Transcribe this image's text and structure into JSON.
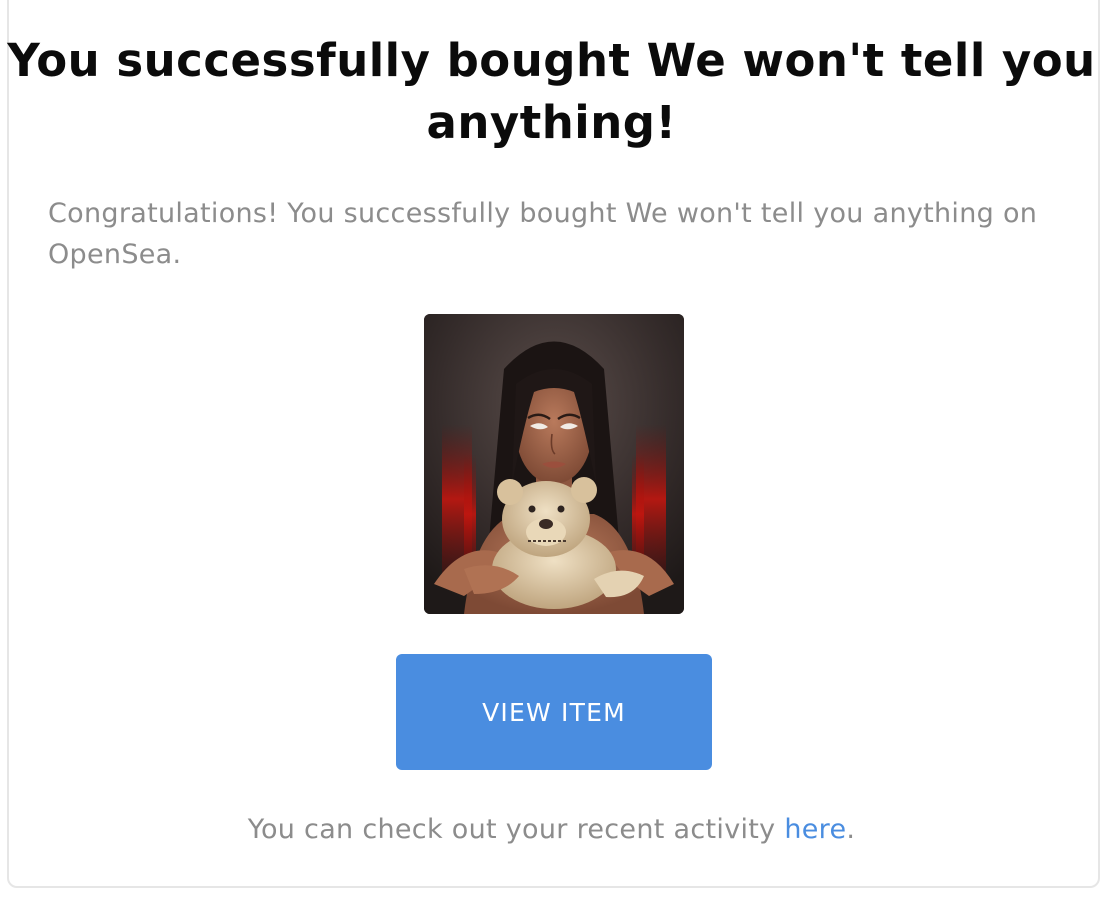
{
  "email": {
    "title": "You successfully bought We won't tell you anything!",
    "message": "Congratulations! You successfully bought We won't tell you anything on OpenSea.",
    "image_alt": "We won't tell you anything",
    "button_label": "VIEW ITEM",
    "footer_prefix": "You can check out your recent activity ",
    "footer_link": "here",
    "footer_suffix": "."
  },
  "colors": {
    "button": "#4a8de0",
    "link": "#4a8de0",
    "title": "#0b0b0b",
    "muted_text": "#8c8c8c"
  }
}
